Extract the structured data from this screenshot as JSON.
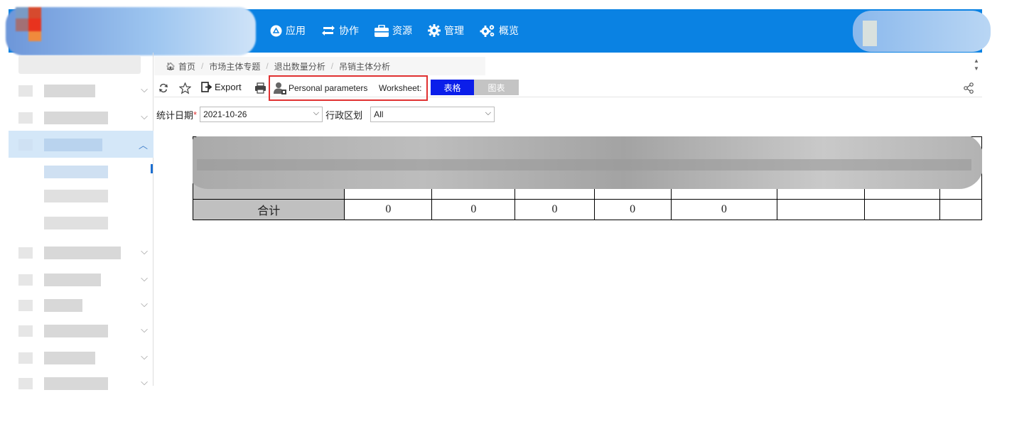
{
  "nav": {
    "items": [
      {
        "label": "应用",
        "icon": "app-circle-icon"
      },
      {
        "label": "协作",
        "icon": "sync-icon"
      },
      {
        "label": "资源",
        "icon": "briefcase-icon"
      },
      {
        "label": "管理",
        "icon": "gear-icon"
      },
      {
        "label": "概览",
        "icon": "gears-icon"
      }
    ]
  },
  "breadcrumb": [
    "首页",
    "市场主体专题",
    "退出数量分析",
    "吊销主体分析"
  ],
  "toolbar": {
    "export_label": "Export",
    "personal_label": "Personal parameters",
    "worksheet_label": "Worksheet:",
    "tab_table": "表格",
    "tab_chart": "图表"
  },
  "filters": {
    "date_label": "统计日期",
    "date_required": "*",
    "date_value": "2021-10-26",
    "region_label": "行政区划",
    "region_value": "All"
  },
  "table": {
    "total_label": "合计",
    "total_values": [
      "0",
      "0",
      "0",
      "0",
      "0",
      "",
      "",
      ""
    ]
  },
  "colors": {
    "topbar": "#0a82e3",
    "tab_active": "#0b1eea",
    "tab_inactive": "#c4c4c4",
    "highlight_box": "#e03131"
  }
}
